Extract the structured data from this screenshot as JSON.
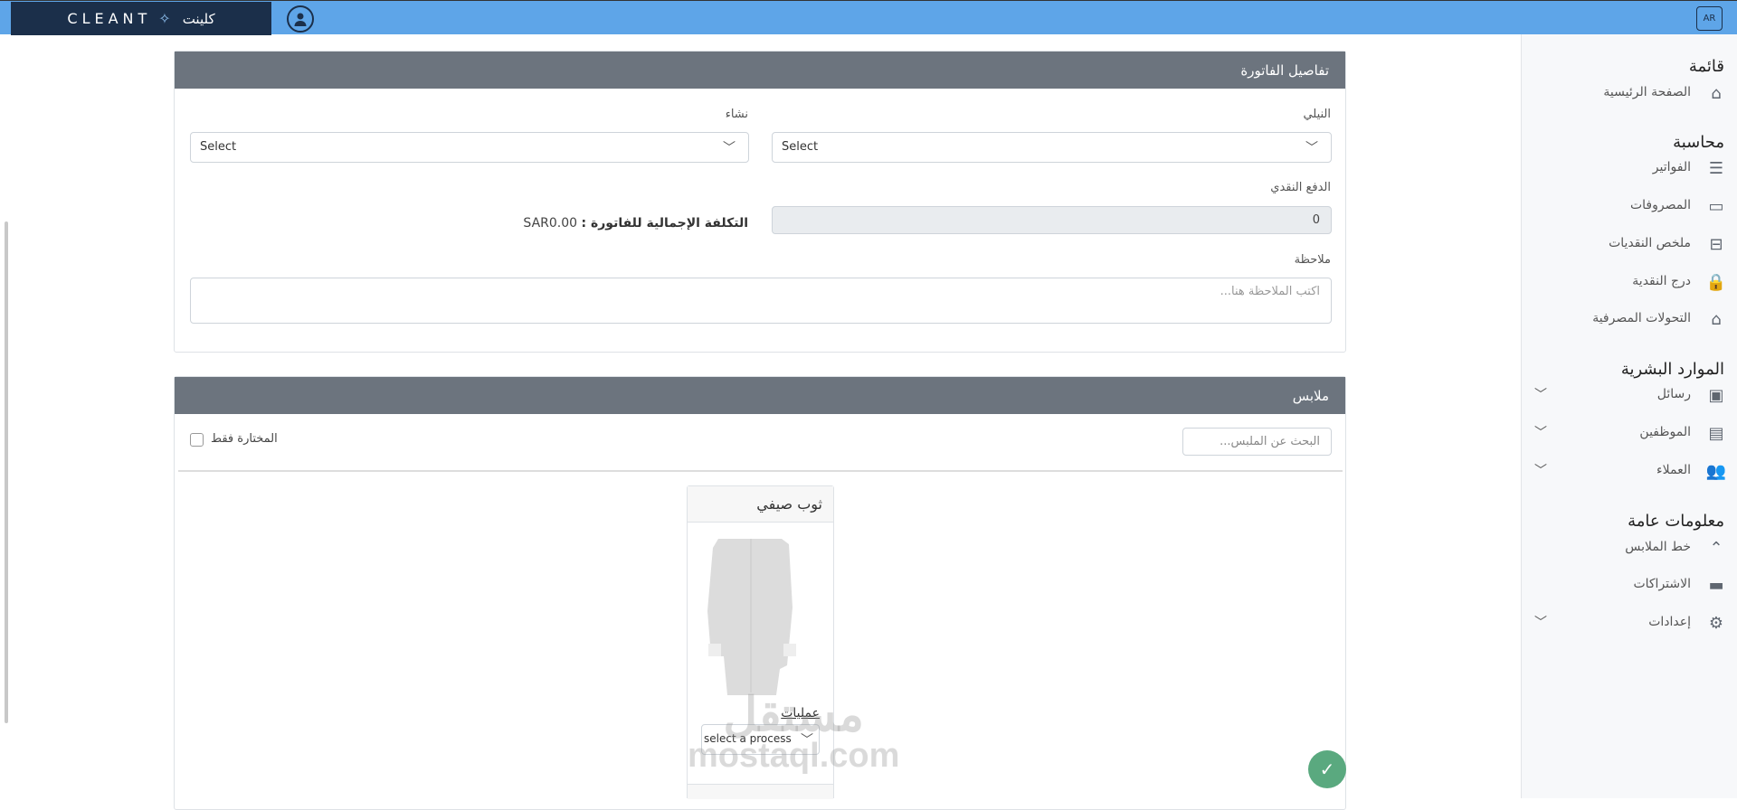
{
  "topbar": {
    "logo_latin": "CLEANT",
    "logo_arabic": "كلينت",
    "lang_button": "AR"
  },
  "sidebar": {
    "sections": [
      {
        "heading": "قائمة",
        "items": [
          {
            "label": "الصفحة الرئيسية",
            "icon": "home-icon"
          }
        ]
      },
      {
        "heading": "محاسبة",
        "items": [
          {
            "label": "الفواتير",
            "icon": "receipt-icon"
          },
          {
            "label": "المصروفات",
            "icon": "money-bill-icon"
          },
          {
            "label": "ملخص النقديات",
            "icon": "cash-register-icon"
          },
          {
            "label": "درج النقدية",
            "icon": "lock-icon"
          },
          {
            "label": "التحولات المصرفية",
            "icon": "bank-icon"
          }
        ]
      },
      {
        "heading": "الموارد البشرية",
        "items": [
          {
            "label": "رسائل",
            "icon": "inbox-icon"
          },
          {
            "label": "الموظفين",
            "icon": "id-badge-icon"
          },
          {
            "label": "العملاء",
            "icon": "users-icon"
          }
        ]
      },
      {
        "heading": "معلومات عامة",
        "items": [
          {
            "label": "خط الملابس",
            "icon": "hanger-icon"
          },
          {
            "label": "الاشتراكات",
            "icon": "subscription-icon"
          },
          {
            "label": "إعدادات",
            "icon": "gears-icon"
          }
        ]
      }
    ]
  },
  "invoice": {
    "title": "تفاصيل الفاتورة",
    "indigo_label": "النيلي",
    "indigo_value": "Select",
    "starch_label": "نشاء",
    "starch_value": "Select",
    "cash_label": "الدفع النقدي",
    "cash_value": "0",
    "total_label": "التكلفة الإجمالية للفاتورة :",
    "total_value": "SAR0.00",
    "note_label": "ملاحظة",
    "note_placeholder": "اكتب الملاحظة هنا..."
  },
  "clothes": {
    "title": "ملابس",
    "search_placeholder": "البحث عن الملبس...",
    "selected_only_label": "المختارة فقط",
    "items": [
      {
        "name": "ثوب صيفي",
        "process_label": "عمليات",
        "process_value": "select a process"
      }
    ]
  },
  "watermark": {
    "arabic": "مستقل",
    "latin": "mostaql.com"
  },
  "colors": {
    "topbar": "#5ea5e8",
    "logo_bg": "#1b2f4a",
    "panel_header": "#6c747e",
    "confirm": "#5aa97f"
  }
}
